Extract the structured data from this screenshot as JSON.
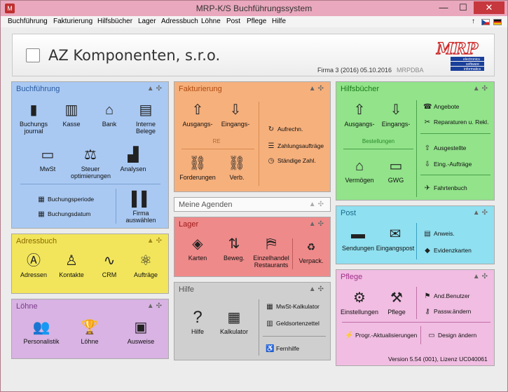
{
  "app": {
    "title": "MRP-K/S Buchführungssystem"
  },
  "window": {
    "min": "—",
    "max": "☐",
    "close": "✕"
  },
  "menu": [
    "Buchführung",
    "Fakturierung",
    "Hilfsbücher",
    "Lager",
    "Adressbuch",
    "Löhne",
    "Post",
    "Pflege",
    "Hilfe"
  ],
  "header": {
    "company": "AZ Komponenten, s.r.o.",
    "firma": "Firma 3 (2016)",
    "date": "05.10.2016",
    "db": "MRPDBA",
    "logo_text": "MRP",
    "logo_lines": [
      "electronics",
      "software",
      "informatics"
    ]
  },
  "buchfuehrung": {
    "title": "Buchführung",
    "items": [
      "Buchungs\njournal",
      "Kasse",
      "Bank",
      "Interne\nBelege",
      "MwSt",
      "Steuer\noptimierungen",
      "Analysen"
    ],
    "small": [
      "Buchungsperiode",
      "Buchungsdatum"
    ],
    "firma": "Firma\nauswählen"
  },
  "adressbuch": {
    "title": "Adressbuch",
    "items": [
      "Adressen",
      "Kontakte",
      "CRM",
      "Aufträge"
    ]
  },
  "loehne": {
    "title": "Löhne",
    "items": [
      "Personalistik",
      "Löhne",
      "Ausweise"
    ]
  },
  "fakturierung": {
    "title": "Fakturierung",
    "items": [
      "Ausgangs-",
      "Eingangs-",
      "Forderungen",
      "Verb."
    ],
    "re": "RE",
    "small": [
      "Aufrechn.",
      "Zahlungsaufträge",
      "Ständige Zahl."
    ]
  },
  "agenden": {
    "title": "Meine Agenden"
  },
  "lager": {
    "title": "Lager",
    "items": [
      "Karten",
      "Beweg.",
      "Einzelhandel\nRestaurants",
      "Verpack."
    ]
  },
  "hilfe": {
    "title": "Hilfe",
    "items": [
      "Hilfe",
      "Kalkulator"
    ],
    "small": [
      "MwSt-Kalkulator",
      "Geldsortenzettel",
      "Fernhilfe"
    ]
  },
  "hilfsbuecher": {
    "title": "Hilfsbücher",
    "items": [
      "Ausgangs-",
      "Eingangs-",
      "Vermögen",
      "GWG"
    ],
    "bestellungen": "Bestellungen",
    "small": [
      "Angebote",
      "Reparaturen u. Rekl.",
      "Ausgestellte",
      "Eing.-Aufträge",
      "Fahrtenbuch"
    ]
  },
  "post": {
    "title": "Post",
    "items": [
      "Sendungen",
      "Eingangspost"
    ],
    "small": [
      "Anweis.",
      "Evidenzkarten"
    ]
  },
  "pflege": {
    "title": "Pflege",
    "items": [
      "Einstellungen",
      "Pflege"
    ],
    "small": [
      "And.Benutzer",
      "Passw.ändern",
      "Progr.-Aktualisierungen",
      "Design ändern"
    ],
    "version": "Version 5.54 (001), Lizenz UC040061"
  },
  "colors": {
    "blue": "#a9c9f3",
    "yellow": "#f2e55c",
    "purple": "#d8b3e3",
    "orange": "#f6b07c",
    "red": "#ef8a8a",
    "gray": "#cfcfcf",
    "green": "#92e38a",
    "cyan": "#8fe0f0",
    "pink": "#f1bde2"
  }
}
